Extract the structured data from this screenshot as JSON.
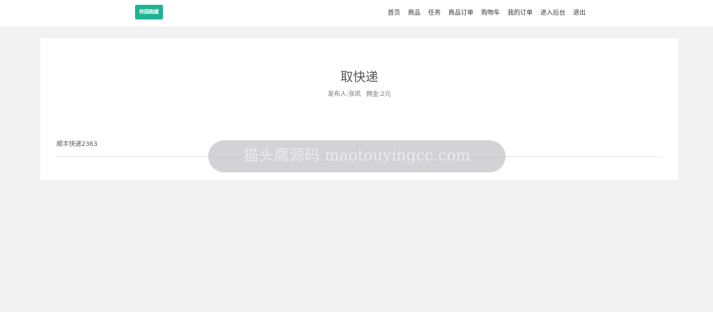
{
  "navbar": {
    "logo_text": "校园跑腿",
    "links": [
      {
        "label": "首页"
      },
      {
        "label": "商品"
      },
      {
        "label": "任务"
      },
      {
        "label": "商品订单"
      },
      {
        "label": "购物车"
      },
      {
        "label": "我的订单"
      },
      {
        "label": "进入后台"
      },
      {
        "label": "退出"
      }
    ]
  },
  "task": {
    "title": "取快递",
    "publisher": "发布人:张凯",
    "commission": "佣金:2元",
    "content": "顺丰快递2363"
  },
  "watermark": {
    "text": "猫头鹰源码 maotouyingcc.com"
  },
  "colors": {
    "accent": "#1fb393",
    "page_background": "#f2f2f2",
    "card_background": "#ffffff"
  }
}
